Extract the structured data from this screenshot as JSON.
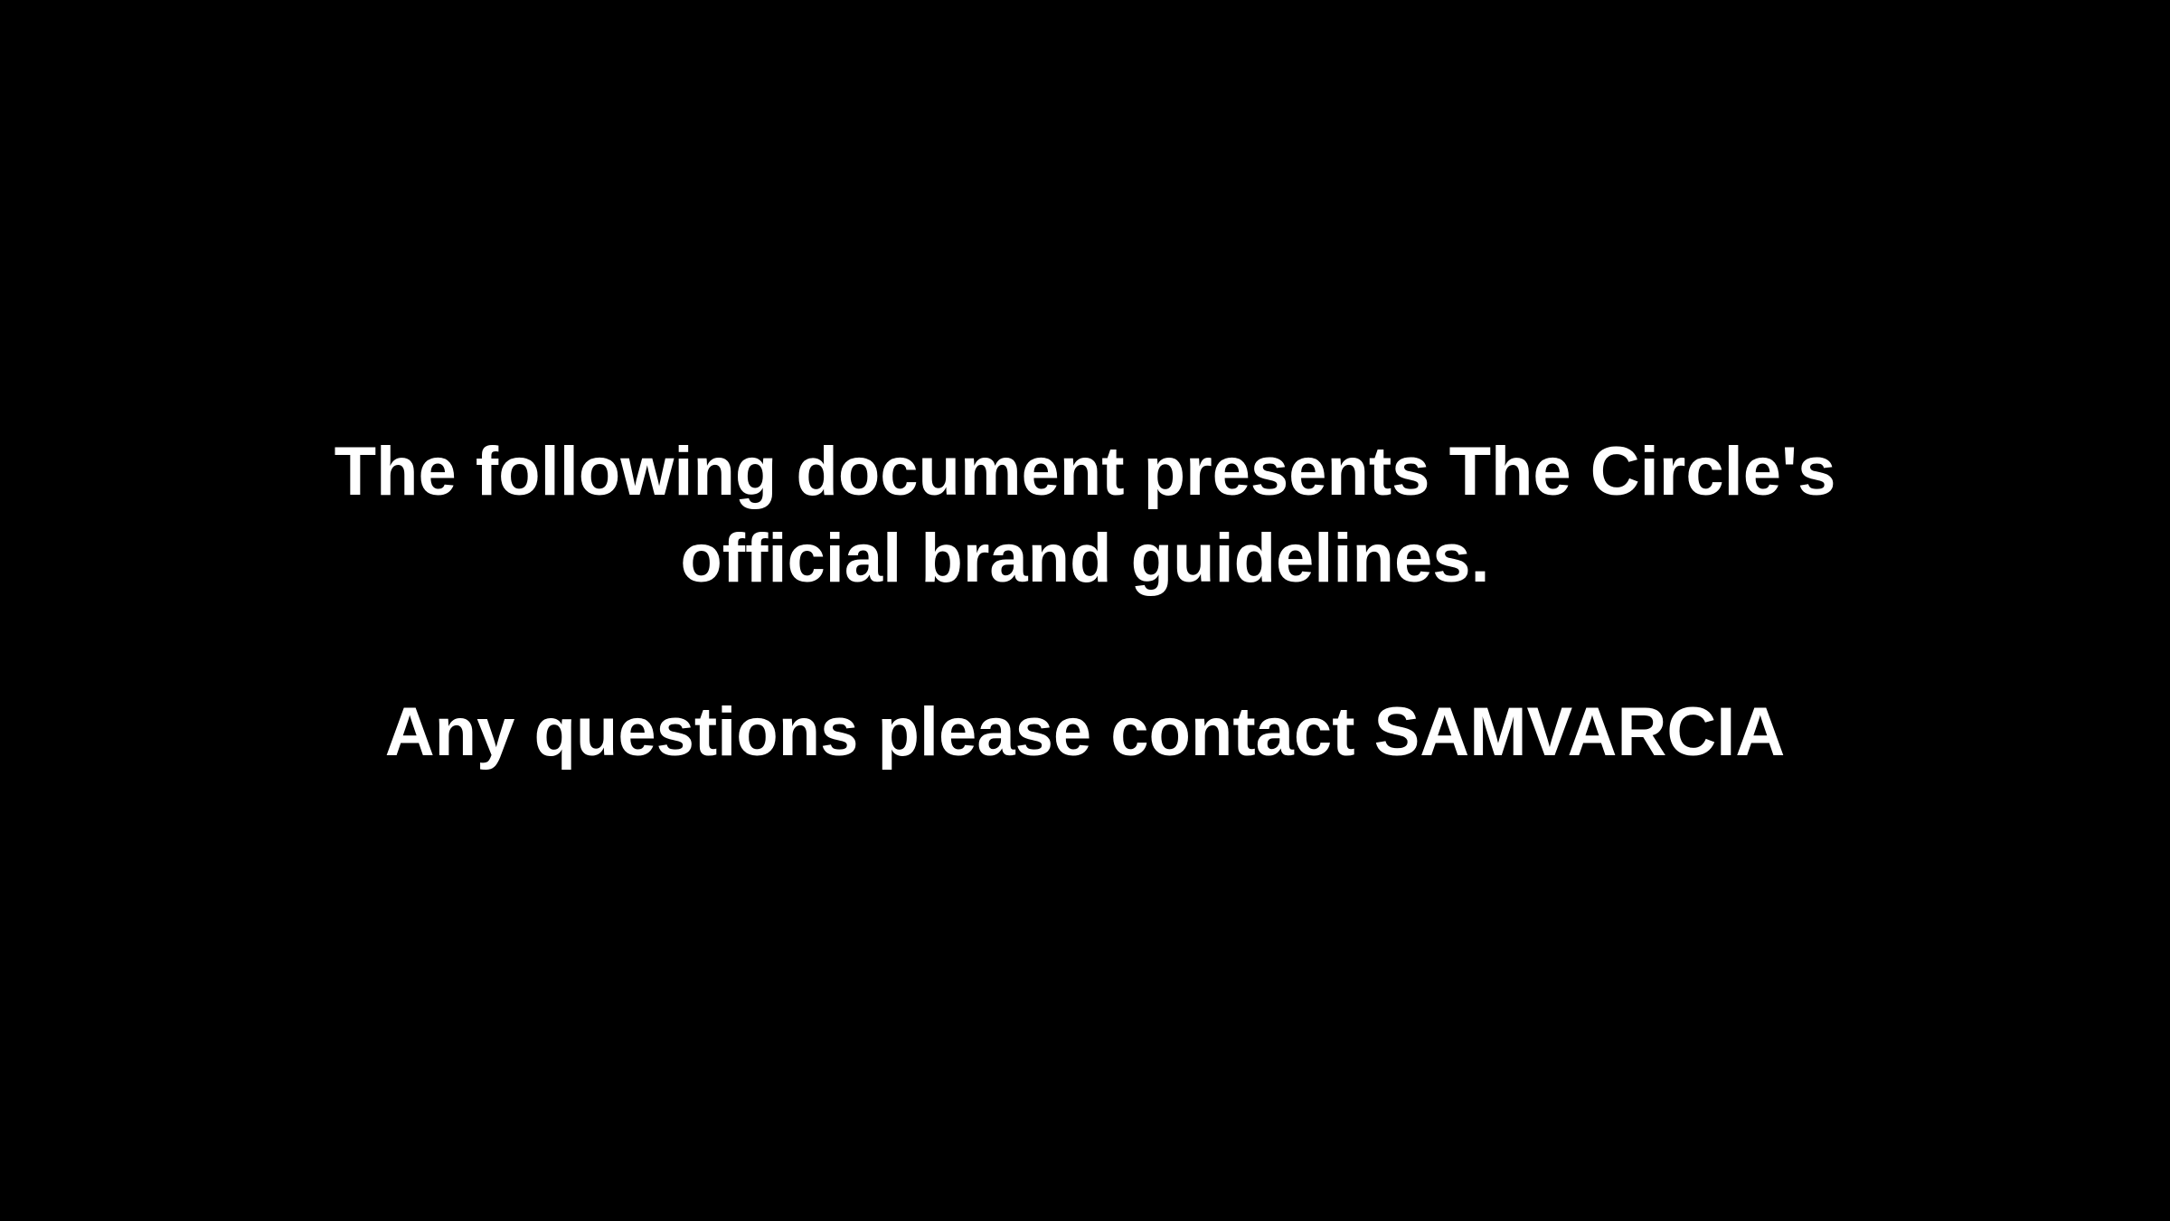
{
  "colors": {
    "background": "#000000",
    "text": "#ffffff"
  },
  "intro": {
    "line1": "The following document presents The Circle's",
    "line2": "official brand guidelines."
  },
  "contact": {
    "text": "Any questions please contact SAMVARCIA"
  }
}
